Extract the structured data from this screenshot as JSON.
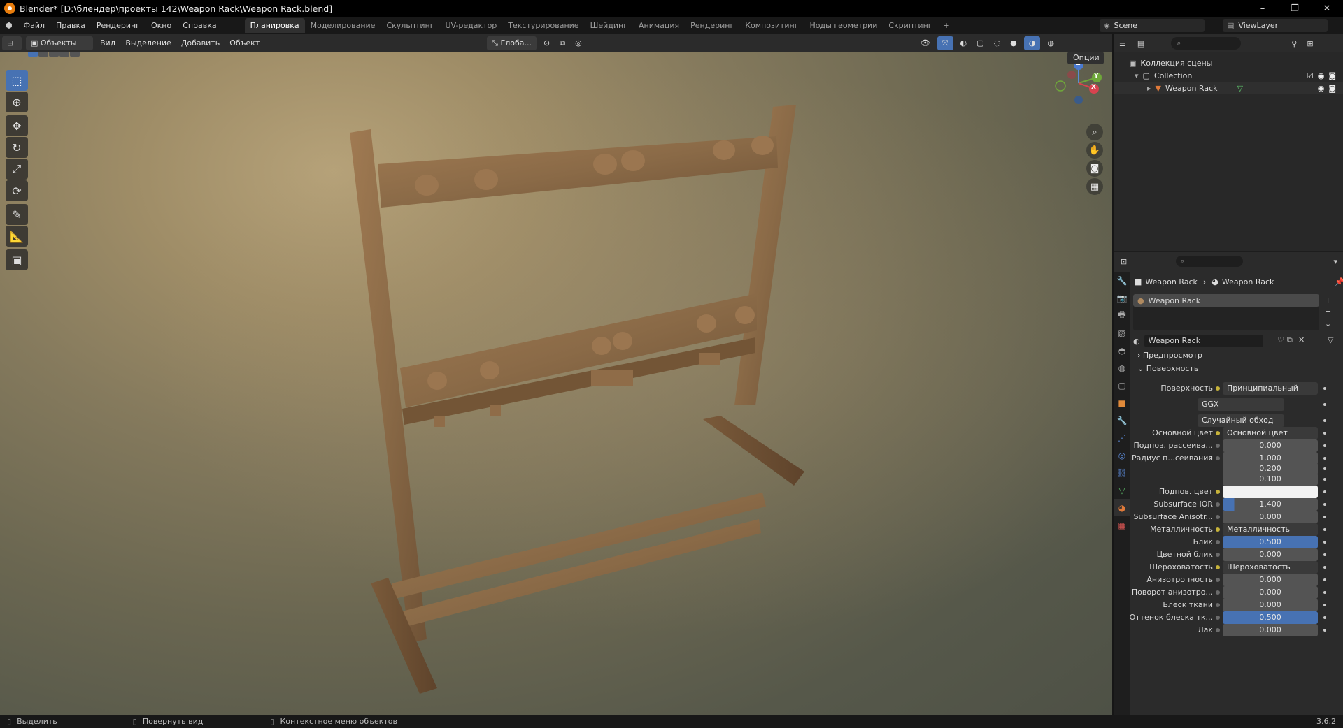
{
  "window": {
    "title": "Blender* [D:\\блендер\\проекты 142\\Weapon Rack\\Weapon Rack.blend]",
    "minimize": "–",
    "maximize": "❐",
    "close": "✕"
  },
  "menu": [
    "Файл",
    "Правка",
    "Рендеринг",
    "Окно",
    "Справка"
  ],
  "workspaces": [
    "Планировка",
    "Моделирование",
    "Скульптинг",
    "UV-редактор",
    "Текстурирование",
    "Шейдинг",
    "Анимация",
    "Рендеринг",
    "Композитинг",
    "Ноды геометрии",
    "Скриптинг"
  ],
  "workspace_add": "+",
  "scene": "Scene",
  "view_layer": "ViewLayer",
  "viewport_header": {
    "mode": "Объекты",
    "menus": [
      "Вид",
      "Выделение",
      "Добавить",
      "Объект"
    ],
    "transform": "Глоба...",
    "options": "Опции"
  },
  "gizmo": {
    "z": "Z",
    "y": "Y",
    "x": "X"
  },
  "outliner": {
    "root": "Коллекция сцены",
    "collection": "Collection",
    "object": "Weapon Rack"
  },
  "properties": {
    "breadcrumb_object": "Weapon Rack",
    "breadcrumb_material": "Weapon Rack",
    "slot": "Weapon Rack",
    "material_name": "Weapon Rack",
    "panel_preview": "Предпросмотр",
    "panel_surface": "Поверхность",
    "rows": [
      {
        "label": "Поверхность",
        "value": "Принципиальный BSDF",
        "kind": "dark"
      },
      {
        "label": "",
        "value": "GGX",
        "kind": "select"
      },
      {
        "label": "",
        "value": "Случайный обход",
        "kind": "select"
      },
      {
        "label": "Основной цвет",
        "value": "Основной цвет",
        "kind": "dark"
      },
      {
        "label": "Подпов. рассеива...",
        "value": "0.000",
        "kind": "num"
      },
      {
        "label": "Радиус п...сеивания",
        "value": "1.000",
        "kind": "num"
      },
      {
        "label": "",
        "value": "0.200",
        "kind": "num"
      },
      {
        "label": "",
        "value": "0.100",
        "kind": "num"
      },
      {
        "label": "Подпов. цвет",
        "value": "",
        "kind": "white"
      },
      {
        "label": "Subsurface IOR",
        "value": "1.400",
        "kind": "numfill"
      },
      {
        "label": "Subsurface Anisotr...",
        "value": "0.000",
        "kind": "num"
      },
      {
        "label": "Металличность",
        "value": "Металличность",
        "kind": "dark"
      },
      {
        "label": "Блик",
        "value": "0.500",
        "kind": "blue"
      },
      {
        "label": "Цветной блик",
        "value": "0.000",
        "kind": "num"
      },
      {
        "label": "Шероховатость",
        "value": "Шероховатость",
        "kind": "dark"
      },
      {
        "label": "Анизотропность",
        "value": "0.000",
        "kind": "num"
      },
      {
        "label": "Поворот анизотро...",
        "value": "0.000",
        "kind": "num"
      },
      {
        "label": "Блеск ткани",
        "value": "0.000",
        "kind": "num"
      },
      {
        "label": "Оттенок блеска тк...",
        "value": "0.500",
        "kind": "blue"
      },
      {
        "label": "Лак",
        "value": "0.000",
        "kind": "num"
      }
    ]
  },
  "status": {
    "select": "Выделить",
    "rotate": "Повернуть вид",
    "context": "Контекстное меню объектов",
    "version": "3.6.2"
  },
  "colors": {
    "accent": "#4772b3",
    "wood": "#8a6a47",
    "material": "#e07a3a"
  }
}
